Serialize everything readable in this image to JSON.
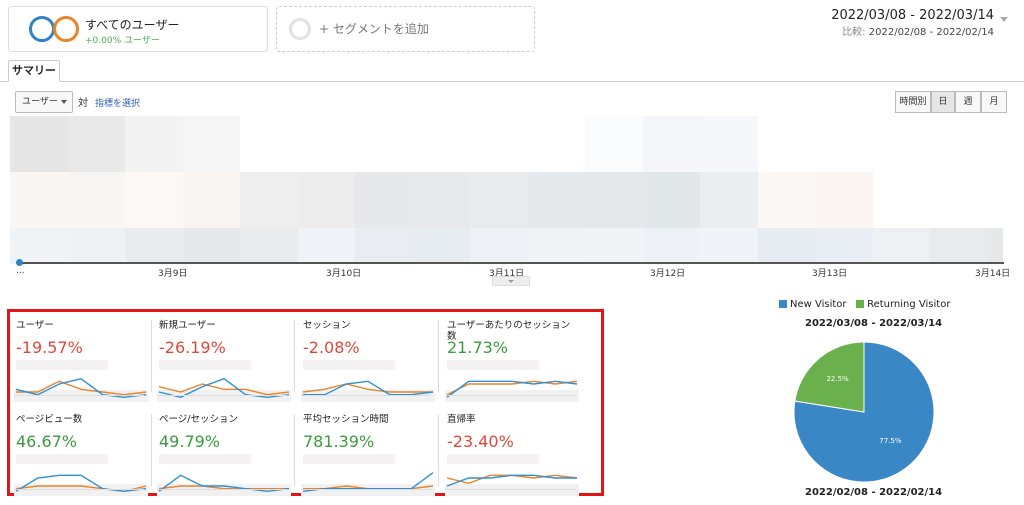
{
  "segments": {
    "main_title": "すべてのユーザー",
    "main_sub": "+0.00% ユーザー",
    "add_label": "+ セグメントを追加"
  },
  "date": {
    "range": "2022/03/08 - 2022/03/14",
    "compare_label": "比較:",
    "compare_range": "2022/02/08 - 2022/02/14"
  },
  "tabs": [
    {
      "label": "サマリー"
    }
  ],
  "controls": {
    "metric": "ユーザー",
    "vs": "対",
    "pick_metric": "指標を選択",
    "granularity": [
      "時間別",
      "日",
      "週",
      "月"
    ],
    "active": "日"
  },
  "chart": {
    "x_labels": [
      "...",
      "3月9日",
      "3月10日",
      "3月11日",
      "3月12日",
      "3月13日",
      "3月14日"
    ]
  },
  "scorecards": [
    {
      "name": "ユーザー",
      "value": "-19.57%",
      "trend": "neg",
      "blue": [
        4,
        2,
        6,
        8,
        2,
        1,
        2
      ],
      "orange": [
        3,
        3,
        7,
        4,
        3,
        2,
        3
      ]
    },
    {
      "name": "新規ユーザー",
      "value": "-26.19%",
      "trend": "neg",
      "blue": [
        3,
        1,
        5,
        8,
        2,
        1,
        2
      ],
      "orange": [
        5,
        3,
        6,
        4,
        4,
        2,
        3
      ]
    },
    {
      "name": "セッション",
      "value": "-2.08%",
      "trend": "neg",
      "blue": [
        2,
        2,
        6,
        7,
        2,
        2,
        3
      ],
      "orange": [
        3,
        4,
        6,
        4,
        3,
        3,
        3
      ]
    },
    {
      "name": "ユーザーあたりのセッション数",
      "value": "21.73%",
      "trend": "pos",
      "blue": [
        1,
        7,
        7,
        7,
        6,
        7,
        6
      ],
      "orange": [
        2,
        6,
        6,
        6,
        7,
        6,
        7
      ]
    },
    {
      "name": "ページビュー数",
      "value": "46.67%",
      "trend": "pos",
      "blue": [
        1,
        6,
        7,
        7,
        2,
        1,
        2
      ],
      "orange": [
        2,
        3,
        3,
        3,
        2,
        1,
        3
      ]
    },
    {
      "name": "ページ/セッション",
      "value": "49.79%",
      "trend": "pos",
      "blue": [
        1,
        7,
        3,
        3,
        2,
        1,
        2
      ],
      "orange": [
        2,
        3,
        3,
        2,
        2,
        2,
        2
      ]
    },
    {
      "name": "平均セッション時間",
      "value": "781.39%",
      "trend": "pos",
      "blue": [
        1,
        2,
        2,
        2,
        2,
        2,
        8
      ],
      "orange": [
        2,
        2,
        3,
        2,
        2,
        2,
        3
      ]
    },
    {
      "name": "直帰率",
      "value": "-23.40%",
      "trend": "neg",
      "blue": [
        3,
        6,
        6,
        7,
        7,
        6,
        6
      ],
      "orange": [
        6,
        4,
        7,
        7,
        6,
        7,
        6
      ]
    }
  ],
  "pie": {
    "legend": [
      {
        "label": "New Visitor",
        "color": "#3a87c6"
      },
      {
        "label": "Returning Visitor",
        "color": "#6ab04c"
      }
    ],
    "title": "2022/03/08 - 2022/03/14",
    "footer": "2022/02/08 - 2022/02/14",
    "slices": [
      {
        "label": "77.5%",
        "value": 77.5,
        "color": "#3a87c6"
      },
      {
        "label": "22.5%",
        "value": 22.5,
        "color": "#6ab04c"
      }
    ]
  },
  "colors": {
    "blue_line": "#2f90d6",
    "orange_line": "#e9842b",
    "highlight_box": "#e21616"
  }
}
